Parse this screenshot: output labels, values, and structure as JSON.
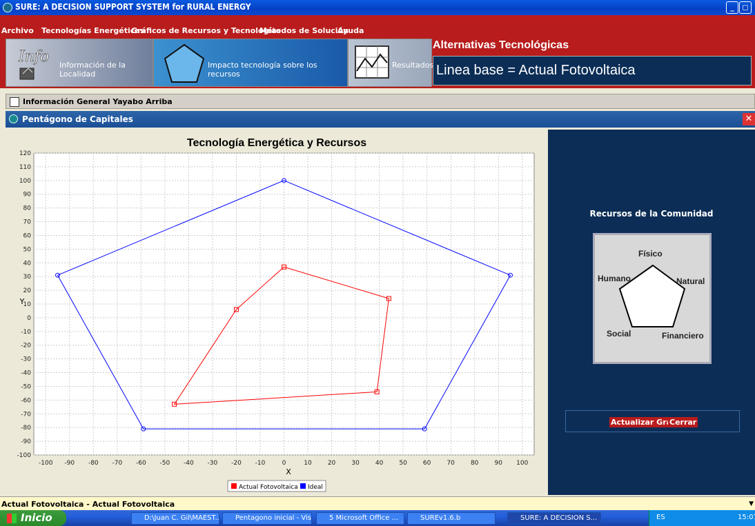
{
  "window": {
    "title": "SURE: A DECISION SUPPORT SYSTEM for RURAL ENERGY"
  },
  "menu": [
    "Archivo",
    "Tecnologías Energéticas",
    "Gráficos de Recursos y Tecnologías",
    "Métodos de Solución",
    "Ayuda"
  ],
  "toolbar": {
    "info_label": "Información de la Localidad",
    "impact_label": "Impacto tecnología sobre los recursos",
    "results_label": "Resultados",
    "alternatives_title": "Alternativas Tecnológicas",
    "baseline_text": "Linea base = Actual Fotovoltaica"
  },
  "frames": {
    "info_title": "Información General Yayabo Arriba",
    "pentagon_title": "Pentágono de Capitales"
  },
  "resources": {
    "title": "Recursos de la Comunidad",
    "labels": {
      "fisico": "Físico",
      "humano": "Humano",
      "natural": "Natural",
      "social": "Social",
      "financiero": "Financiero"
    },
    "update_button": "Actualizar Grafo",
    "close_button": "Cerrar"
  },
  "status_text": "Actual Fotovoltaica - Actual Fotovoltaica",
  "taskbar": {
    "start": "Inicio",
    "tasks": [
      "D:\\Juan C. Gil\\MAEST...",
      "Pentagono inicial - Vis...",
      "5 Microsoft Office ...",
      "SUREv1.6.b",
      "SURE: A DECISION S..."
    ],
    "lang": "ES",
    "clock": "15:07"
  },
  "colors": {
    "menu_red": "#b81c1c",
    "panel_navy": "#0b2d56",
    "actual_series": "#ff0000",
    "ideal_series": "#0000ff"
  },
  "chart_data": {
    "type": "scatter",
    "title": "Tecnología Energética y Recursos",
    "xlabel": "X",
    "ylabel": "Y",
    "xlim": [
      -105,
      105
    ],
    "ylim": [
      -100,
      120
    ],
    "xticks": [
      -100,
      -90,
      -80,
      -70,
      -60,
      -50,
      -40,
      -30,
      -20,
      -10,
      0,
      10,
      20,
      30,
      40,
      50,
      60,
      70,
      80,
      90,
      100
    ],
    "yticks": [
      -100,
      -90,
      -80,
      -70,
      -60,
      -50,
      -40,
      -30,
      -20,
      -10,
      0,
      10,
      20,
      30,
      40,
      50,
      60,
      70,
      80,
      90,
      100,
      110,
      120
    ],
    "grid": true,
    "legend": "bottom",
    "series": [
      {
        "name": "Actual Fotovoltaica",
        "color": "#ff0000",
        "marker": "square",
        "closed": true,
        "points": [
          [
            0,
            37
          ],
          [
            44,
            14
          ],
          [
            39,
            -54
          ],
          [
            -46,
            -63
          ],
          [
            -20,
            6
          ]
        ]
      },
      {
        "name": "Ideal",
        "color": "#0000ff",
        "marker": "circle",
        "closed": true,
        "points": [
          [
            0,
            100
          ],
          [
            95,
            31
          ],
          [
            59,
            -81
          ],
          [
            -59,
            -81
          ],
          [
            -95,
            31
          ]
        ]
      }
    ]
  }
}
